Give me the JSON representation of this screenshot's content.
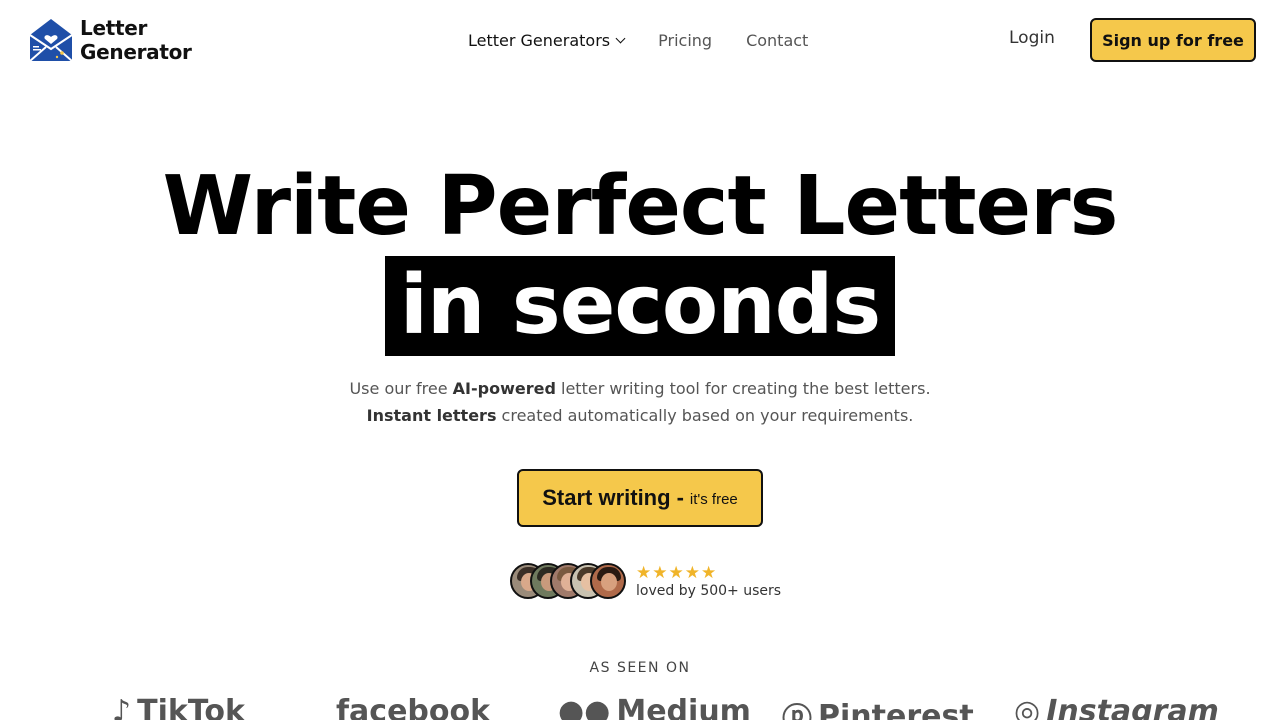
{
  "logo": {
    "line1": "Letter",
    "line2": "Generator"
  },
  "nav": {
    "items": [
      {
        "label": "Letter Generators",
        "has_dropdown": true
      },
      {
        "label": "Pricing"
      },
      {
        "label": "Contact"
      }
    ],
    "login": "Login",
    "signup": "Sign up for free"
  },
  "hero": {
    "title": "Write Perfect Letters",
    "highlight": "in seconds",
    "sub1_pre": "Use our free ",
    "sub1_bold": "AI-powered",
    "sub1_post": " letter writing tool for creating the best letters.",
    "sub2_bold": "Instant letters",
    "sub2_post": " created automatically based on your requirements."
  },
  "cta": {
    "main": "Start writing",
    "dash": "-",
    "sub": "it's free"
  },
  "social_proof": {
    "rating": 5,
    "text": "loved by 500+ users"
  },
  "seen_on": {
    "label": "AS SEEN ON",
    "brands": [
      "TikTok",
      "facebook",
      "Medium",
      "Pinterest",
      "Instagram"
    ]
  },
  "colors": {
    "accent": "#f5c84b",
    "star": "#f0b429",
    "text": "#111111",
    "logo_blue": "#1f4fa8"
  }
}
